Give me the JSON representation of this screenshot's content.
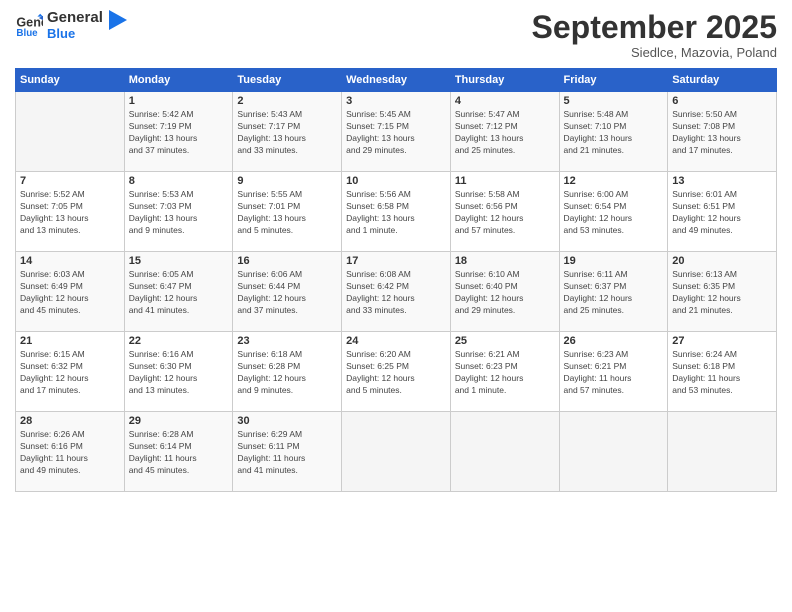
{
  "header": {
    "logo_line1": "General",
    "logo_line2": "Blue",
    "month": "September 2025",
    "location": "Siedlce, Mazovia, Poland"
  },
  "days_of_week": [
    "Sunday",
    "Monday",
    "Tuesday",
    "Wednesday",
    "Thursday",
    "Friday",
    "Saturday"
  ],
  "weeks": [
    [
      {
        "day": "",
        "info": ""
      },
      {
        "day": "1",
        "info": "Sunrise: 5:42 AM\nSunset: 7:19 PM\nDaylight: 13 hours\nand 37 minutes."
      },
      {
        "day": "2",
        "info": "Sunrise: 5:43 AM\nSunset: 7:17 PM\nDaylight: 13 hours\nand 33 minutes."
      },
      {
        "day": "3",
        "info": "Sunrise: 5:45 AM\nSunset: 7:15 PM\nDaylight: 13 hours\nand 29 minutes."
      },
      {
        "day": "4",
        "info": "Sunrise: 5:47 AM\nSunset: 7:12 PM\nDaylight: 13 hours\nand 25 minutes."
      },
      {
        "day": "5",
        "info": "Sunrise: 5:48 AM\nSunset: 7:10 PM\nDaylight: 13 hours\nand 21 minutes."
      },
      {
        "day": "6",
        "info": "Sunrise: 5:50 AM\nSunset: 7:08 PM\nDaylight: 13 hours\nand 17 minutes."
      }
    ],
    [
      {
        "day": "7",
        "info": "Sunrise: 5:52 AM\nSunset: 7:05 PM\nDaylight: 13 hours\nand 13 minutes."
      },
      {
        "day": "8",
        "info": "Sunrise: 5:53 AM\nSunset: 7:03 PM\nDaylight: 13 hours\nand 9 minutes."
      },
      {
        "day": "9",
        "info": "Sunrise: 5:55 AM\nSunset: 7:01 PM\nDaylight: 13 hours\nand 5 minutes."
      },
      {
        "day": "10",
        "info": "Sunrise: 5:56 AM\nSunset: 6:58 PM\nDaylight: 13 hours\nand 1 minute."
      },
      {
        "day": "11",
        "info": "Sunrise: 5:58 AM\nSunset: 6:56 PM\nDaylight: 12 hours\nand 57 minutes."
      },
      {
        "day": "12",
        "info": "Sunrise: 6:00 AM\nSunset: 6:54 PM\nDaylight: 12 hours\nand 53 minutes."
      },
      {
        "day": "13",
        "info": "Sunrise: 6:01 AM\nSunset: 6:51 PM\nDaylight: 12 hours\nand 49 minutes."
      }
    ],
    [
      {
        "day": "14",
        "info": "Sunrise: 6:03 AM\nSunset: 6:49 PM\nDaylight: 12 hours\nand 45 minutes."
      },
      {
        "day": "15",
        "info": "Sunrise: 6:05 AM\nSunset: 6:47 PM\nDaylight: 12 hours\nand 41 minutes."
      },
      {
        "day": "16",
        "info": "Sunrise: 6:06 AM\nSunset: 6:44 PM\nDaylight: 12 hours\nand 37 minutes."
      },
      {
        "day": "17",
        "info": "Sunrise: 6:08 AM\nSunset: 6:42 PM\nDaylight: 12 hours\nand 33 minutes."
      },
      {
        "day": "18",
        "info": "Sunrise: 6:10 AM\nSunset: 6:40 PM\nDaylight: 12 hours\nand 29 minutes."
      },
      {
        "day": "19",
        "info": "Sunrise: 6:11 AM\nSunset: 6:37 PM\nDaylight: 12 hours\nand 25 minutes."
      },
      {
        "day": "20",
        "info": "Sunrise: 6:13 AM\nSunset: 6:35 PM\nDaylight: 12 hours\nand 21 minutes."
      }
    ],
    [
      {
        "day": "21",
        "info": "Sunrise: 6:15 AM\nSunset: 6:32 PM\nDaylight: 12 hours\nand 17 minutes."
      },
      {
        "day": "22",
        "info": "Sunrise: 6:16 AM\nSunset: 6:30 PM\nDaylight: 12 hours\nand 13 minutes."
      },
      {
        "day": "23",
        "info": "Sunrise: 6:18 AM\nSunset: 6:28 PM\nDaylight: 12 hours\nand 9 minutes."
      },
      {
        "day": "24",
        "info": "Sunrise: 6:20 AM\nSunset: 6:25 PM\nDaylight: 12 hours\nand 5 minutes."
      },
      {
        "day": "25",
        "info": "Sunrise: 6:21 AM\nSunset: 6:23 PM\nDaylight: 12 hours\nand 1 minute."
      },
      {
        "day": "26",
        "info": "Sunrise: 6:23 AM\nSunset: 6:21 PM\nDaylight: 11 hours\nand 57 minutes."
      },
      {
        "day": "27",
        "info": "Sunrise: 6:24 AM\nSunset: 6:18 PM\nDaylight: 11 hours\nand 53 minutes."
      }
    ],
    [
      {
        "day": "28",
        "info": "Sunrise: 6:26 AM\nSunset: 6:16 PM\nDaylight: 11 hours\nand 49 minutes."
      },
      {
        "day": "29",
        "info": "Sunrise: 6:28 AM\nSunset: 6:14 PM\nDaylight: 11 hours\nand 45 minutes."
      },
      {
        "day": "30",
        "info": "Sunrise: 6:29 AM\nSunset: 6:11 PM\nDaylight: 11 hours\nand 41 minutes."
      },
      {
        "day": "",
        "info": ""
      },
      {
        "day": "",
        "info": ""
      },
      {
        "day": "",
        "info": ""
      },
      {
        "day": "",
        "info": ""
      }
    ]
  ]
}
